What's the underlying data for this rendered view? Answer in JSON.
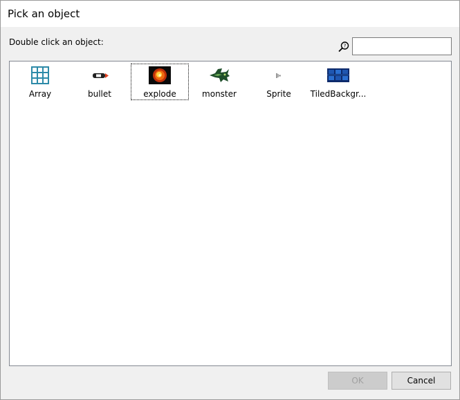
{
  "dialog": {
    "title": "Pick an object",
    "prompt": "Double click an object:"
  },
  "search": {
    "value": "",
    "placeholder": "",
    "icon": "search-icon"
  },
  "objects": [
    {
      "label": "Array",
      "icon": "array-grid-icon",
      "selected": false
    },
    {
      "label": "bullet",
      "icon": "bullet-icon",
      "selected": false
    },
    {
      "label": "explode",
      "icon": "explosion-icon",
      "selected": true
    },
    {
      "label": "monster",
      "icon": "monster-icon",
      "selected": false
    },
    {
      "label": "Sprite",
      "icon": "sprite-icon",
      "selected": false
    },
    {
      "label": "TiledBackgr...",
      "icon": "tiled-background-icon",
      "selected": false
    }
  ],
  "buttons": {
    "ok_label": "OK",
    "ok_enabled": false,
    "cancel_label": "Cancel"
  },
  "colors": {
    "array_icon": "#2c8aa8",
    "selection_outline": "#000000"
  }
}
